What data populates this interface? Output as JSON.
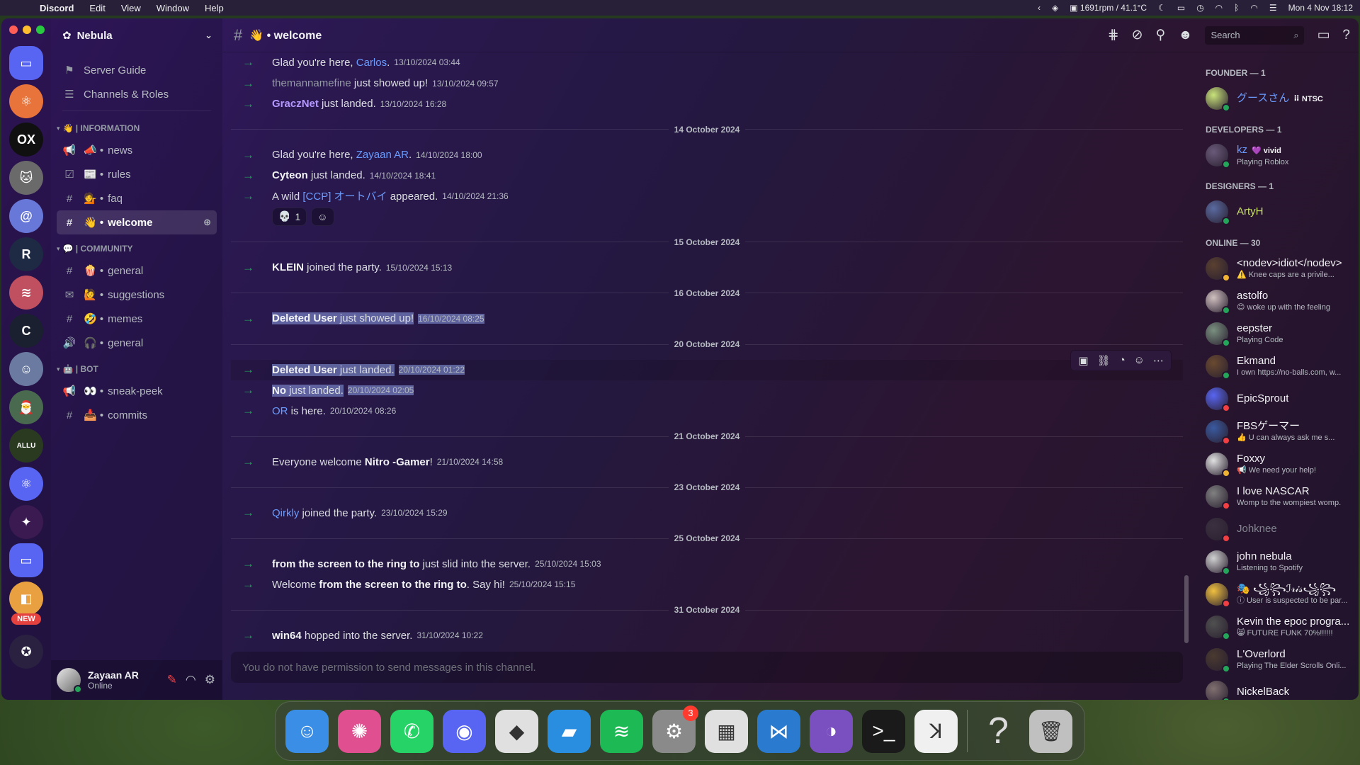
{
  "menubar": {
    "app": "Discord",
    "items": [
      "Edit",
      "View",
      "Window",
      "Help"
    ],
    "stats": "1691rpm / 41.1°C",
    "datetime": "Mon 4 Nov  18:12"
  },
  "server": {
    "name": "Nebula",
    "top_items": [
      {
        "icon": "server-guide-icon",
        "label": "Server Guide"
      },
      {
        "icon": "channels-roles-icon",
        "label": "Channels & Roles"
      }
    ],
    "categories": [
      {
        "name": "👋 | INFORMATION",
        "channels": [
          {
            "type": "announcement",
            "emoji": "📣",
            "label": "news"
          },
          {
            "type": "rules",
            "emoji": "📰",
            "label": "rules"
          },
          {
            "type": "text",
            "emoji": "💁",
            "label": "faq"
          },
          {
            "type": "text",
            "emoji": "👋",
            "label": "welcome",
            "active": true
          }
        ]
      },
      {
        "name": "💬 | COMMUNITY",
        "channels": [
          {
            "type": "text",
            "emoji": "🍿",
            "label": "general"
          },
          {
            "type": "forum",
            "emoji": "🙋",
            "label": "suggestions"
          },
          {
            "type": "text",
            "emoji": "🤣",
            "label": "memes"
          },
          {
            "type": "voice",
            "emoji": "🎧",
            "label": "general"
          }
        ]
      },
      {
        "name": "🤖 | BOT",
        "channels": [
          {
            "type": "announcement",
            "emoji": "👀",
            "label": "sneak-peek"
          },
          {
            "type": "text",
            "emoji": "📥",
            "label": "commits"
          }
        ]
      }
    ]
  },
  "user": {
    "name": "Zayaan AR",
    "status": "Online"
  },
  "channel": {
    "title": "👋 • welcome"
  },
  "search": {
    "placeholder": "Search"
  },
  "messages": [
    {
      "kind": "msg",
      "pre": "Glad you're here, ",
      "name": "Carlos",
      "nameStyle": "blue",
      "post": ".",
      "ts": "13/10/2024 03:44"
    },
    {
      "kind": "msg",
      "pre": "",
      "name": "themannamefine",
      "nameStyle": "muted",
      "post": " just showed up!",
      "ts": "13/10/2024 09:57"
    },
    {
      "kind": "msg",
      "pre": "",
      "name": "GraczNet",
      "nameStyle": "purple",
      "post": " just landed.",
      "ts": "13/10/2024 16:28"
    },
    {
      "kind": "date",
      "label": "14 October 2024"
    },
    {
      "kind": "msg",
      "pre": "Glad you're here, ",
      "name": "Zayaan AR",
      "nameStyle": "blue",
      "post": ".",
      "ts": "14/10/2024 18:00"
    },
    {
      "kind": "msg",
      "pre": "",
      "name": "Cyteon",
      "nameStyle": "bold",
      "post": " just landed.",
      "ts": "14/10/2024 18:41"
    },
    {
      "kind": "msg",
      "pre": "A wild ",
      "name": "[CCP] オートバイ",
      "nameStyle": "blue",
      "post": " appeared.",
      "ts": "14/10/2024 21:36",
      "reactions": [
        {
          "emoji": "💀",
          "count": "1"
        },
        {
          "emoji": "☺",
          "count": ""
        }
      ]
    },
    {
      "kind": "date",
      "label": "15 October 2024"
    },
    {
      "kind": "msg",
      "pre": "",
      "name": "KLEIN",
      "nameStyle": "bold",
      "post": " joined the party.",
      "ts": "15/10/2024 15:13"
    },
    {
      "kind": "date",
      "label": "16 October 2024"
    },
    {
      "kind": "msg",
      "pre": "",
      "name": "Deleted User",
      "nameStyle": "bold",
      "post": " just showed up!",
      "ts": "16/10/2024 08:25",
      "selected": true
    },
    {
      "kind": "date",
      "label": "20 October 2024"
    },
    {
      "kind": "msg",
      "pre": "",
      "name": "Deleted User",
      "nameStyle": "bold",
      "post": " just landed.",
      "ts": "20/10/2024 01:22",
      "selected": true,
      "hover": true
    },
    {
      "kind": "msg",
      "pre": "",
      "name": "No",
      "nameStyle": "bold",
      "post": " just landed.",
      "ts": "20/10/2024 02:05",
      "selected": true
    },
    {
      "kind": "msg",
      "pre": "",
      "name": "OR",
      "nameStyle": "blue",
      "post": " is here.",
      "ts": "20/10/2024 08:26"
    },
    {
      "kind": "date",
      "label": "21 October 2024"
    },
    {
      "kind": "msg",
      "pre": "Everyone welcome ",
      "name": "Nitro -Gamer",
      "nameStyle": "bold",
      "post": "!",
      "ts": "21/10/2024 14:58"
    },
    {
      "kind": "date",
      "label": "23 October 2024"
    },
    {
      "kind": "msg",
      "pre": "",
      "name": "Qirkly",
      "nameStyle": "blue",
      "post": " joined the party.",
      "ts": "23/10/2024 15:29"
    },
    {
      "kind": "date",
      "label": "25 October 2024"
    },
    {
      "kind": "msg",
      "pre": "",
      "name": "from the screen to the ring to",
      "nameStyle": "bold",
      "post": " just slid into the server.",
      "ts": "25/10/2024 15:03"
    },
    {
      "kind": "msg",
      "pre": "Welcome ",
      "name": "from the screen to the ring to",
      "nameStyle": "bold",
      "post": ". Say hi!",
      "ts": "25/10/2024 15:15"
    },
    {
      "kind": "date",
      "label": "31 October 2024"
    },
    {
      "kind": "msg",
      "pre": "",
      "name": "win64",
      "nameStyle": "bold",
      "post": " hopped into the server.",
      "ts": "31/10/2024 10:22"
    }
  ],
  "composer": {
    "placeholder": "You do not have permission to send messages in this channel."
  },
  "members": [
    {
      "group": "FOUNDER — 1",
      "list": [
        {
          "name": "グースさん",
          "tag": "⠿ NTSC",
          "sub": "",
          "color": "#6a9cff",
          "av": "#c9e37a",
          "status": "#23a55a"
        }
      ]
    },
    {
      "group": "DEVELOPERS — 1",
      "list": [
        {
          "name": "kz",
          "tag": "💜 vivid",
          "sub": "Playing Roblox",
          "color": "#6a9cff",
          "av": "#6a5a7a",
          "status": "#23a55a"
        }
      ]
    },
    {
      "group": "DESIGNERS — 1",
      "list": [
        {
          "name": "ArtyH",
          "tag": "",
          "sub": "",
          "color": "#c7e06a",
          "av": "#5a6aa0",
          "status": "#23a55a"
        }
      ]
    },
    {
      "group": "ONLINE — 30",
      "list": [
        {
          "name": "<nodev>idiot</nodev>",
          "tag": "",
          "sub": "⚠️ Knee caps are a privile...",
          "color": "#f2f3f5",
          "av": "#5a4030",
          "status": "#f0b232"
        },
        {
          "name": "astolfo",
          "tag": "",
          "sub": "😊 woke up with the feeling",
          "color": "#f2f3f5",
          "av": "#d0c0c0",
          "status": "#23a55a"
        },
        {
          "name": "eepster",
          "tag": "",
          "sub": "Playing Code",
          "color": "#f2f3f5",
          "av": "#7a9080",
          "status": "#23a55a"
        },
        {
          "name": "Ekmand",
          "tag": "",
          "sub": "I own https://no-balls.com, w...",
          "color": "#f2f3f5",
          "av": "#6a4a30",
          "status": "#23a55a"
        },
        {
          "name": "EpicSprout",
          "tag": "",
          "sub": "",
          "color": "#f2f3f5",
          "av": "#5865f2",
          "status": "#f23f43"
        },
        {
          "name": "FBSゲーマー",
          "tag": "",
          "sub": "👍 U can always ask me s...",
          "color": "#f2f3f5",
          "av": "#3a5aa0",
          "status": "#f23f43"
        },
        {
          "name": "Foxxy",
          "tag": "",
          "sub": "📢 We need your help!",
          "color": "#f2f3f5",
          "av": "#e0e0e0",
          "status": "#f0b232"
        },
        {
          "name": "I love NASCAR",
          "tag": "",
          "sub": "Womp to the wompiest womp.",
          "color": "#f2f3f5",
          "av": "#808080",
          "status": "#f23f43"
        },
        {
          "name": "Johknee",
          "tag": "",
          "sub": "",
          "color": "#80848e",
          "av": "#3a3040",
          "status": "#f23f43",
          "dim": true
        },
        {
          "name": "john nebula",
          "tag": "",
          "sub": "Listening to Spotify",
          "color": "#f2f3f5",
          "av": "#d0d0d0",
          "status": "#23a55a"
        },
        {
          "name": "🎭 ꧁꧂ℐ𝓇𝒾𝓈꧁꧂",
          "tag": "",
          "sub": "ⓘ User is suspected to be par...",
          "color": "#f2f3f5",
          "av": "#f0c040",
          "status": "#f23f43"
        },
        {
          "name": "Kevin the epoc progra...",
          "tag": "",
          "sub": "😸 FUTURE FUNK 70%!!!!!!",
          "color": "#f2f3f5",
          "av": "#505050",
          "status": "#23a55a"
        },
        {
          "name": "L'Overlord",
          "tag": "",
          "sub": "Playing The Elder Scrolls Onli...",
          "color": "#f2f3f5",
          "av": "#4a3a30",
          "status": "#23a55a"
        },
        {
          "name": "NickelBack",
          "tag": "",
          "sub": "",
          "color": "#f2f3f5",
          "av": "#807070",
          "status": "#23a55a"
        }
      ]
    }
  ],
  "servers": [
    {
      "name": "folder-server",
      "color": "#5865f2",
      "glyph": "▭",
      "square": true
    },
    {
      "name": "atom-server",
      "color": "#e8743b",
      "glyph": "⚛"
    },
    {
      "name": "ox-server",
      "color": "#101010",
      "glyph": "OX"
    },
    {
      "name": "cat-server",
      "color": "#6a6a6a",
      "glyph": "🐱"
    },
    {
      "name": "someone-server",
      "color": "#6878d8",
      "glyph": "@"
    },
    {
      "name": "r-server",
      "color": "#1e2a44",
      "glyph": "R"
    },
    {
      "name": "stripe-server",
      "color": "#c05060",
      "glyph": "≋"
    },
    {
      "name": "c-server",
      "color": "#1a2030",
      "glyph": "C"
    },
    {
      "name": "anime-server",
      "color": "#6a7aa0",
      "glyph": "☺"
    },
    {
      "name": "santa-server",
      "color": "#4a6a50",
      "glyph": "🎅"
    },
    {
      "name": "allu-server",
      "color": "#2a3a20",
      "glyph": "ALLU"
    },
    {
      "name": "react-server",
      "color": "#5865f2",
      "glyph": "⚛"
    },
    {
      "name": "sparkle-server",
      "color": "#3a1a50",
      "glyph": "✦"
    },
    {
      "name": "folder2-server",
      "color": "#5865f2",
      "glyph": "▭",
      "square": true
    },
    {
      "name": "colors-server",
      "color": "#e8a040",
      "glyph": "◧"
    }
  ],
  "new_label": "NEW",
  "dock": [
    {
      "name": "finder",
      "color": "#3a8ee6",
      "glyph": "☺"
    },
    {
      "name": "ai-app",
      "color": "#e05090",
      "glyph": "✺"
    },
    {
      "name": "whatsapp",
      "color": "#25d366",
      "glyph": "✆"
    },
    {
      "name": "discord",
      "color": "#5865f2",
      "glyph": "◉"
    },
    {
      "name": "roblox",
      "color": "#e0e0e0",
      "glyph": "◆"
    },
    {
      "name": "roblox-studio",
      "color": "#2a8ee0",
      "glyph": "▰"
    },
    {
      "name": "spotify",
      "color": "#1db954",
      "glyph": "≋"
    },
    {
      "name": "system-settings",
      "color": "#8a8a8a",
      "glyph": "⚙",
      "badge": "3"
    },
    {
      "name": "launchpad",
      "color": "#e0e0e0",
      "glyph": "▦"
    },
    {
      "name": "vscode",
      "color": "#2a7ad0",
      "glyph": "⋈"
    },
    {
      "name": "github-desktop",
      "color": "#7a50c0",
      "glyph": "◑"
    },
    {
      "name": "terminal",
      "color": "#1a1a1a",
      "glyph": ">_"
    },
    {
      "name": "figure-app",
      "color": "#f0f0f0",
      "glyph": "ꓘ"
    },
    {
      "name": "help-app",
      "color": "transparent",
      "glyph": "?"
    },
    {
      "name": "trash",
      "color": "#c0c0c0",
      "glyph": "🗑"
    }
  ]
}
